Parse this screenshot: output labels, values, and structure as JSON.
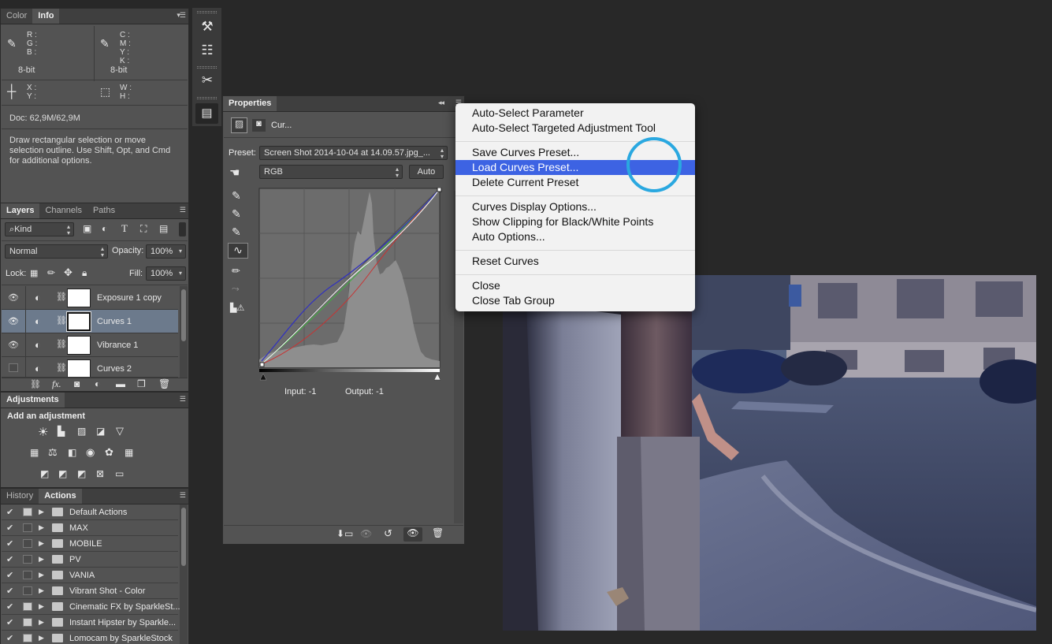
{
  "info_panel": {
    "tabs": [
      "Color",
      "Info"
    ],
    "rgb_labels": [
      "R :",
      "G :",
      "B :"
    ],
    "cmyk_labels": [
      "C :",
      "M :",
      "Y :",
      "K :"
    ],
    "bit_left": "8-bit",
    "bit_right": "8-bit",
    "xy_labels": [
      "X :",
      "Y :"
    ],
    "wh_labels": [
      "W :",
      "H :"
    ],
    "doc": "Doc: 62,9M/62,9M",
    "hint": "Draw rectangular selection or move selection outline.  Use Shift, Opt, and Cmd for additional options."
  },
  "layers_panel": {
    "tabs": [
      "Layers",
      "Channels",
      "Paths"
    ],
    "kind": "Kind",
    "blend_mode": "Normal",
    "opacity_label": "Opacity:",
    "opacity_value": "100%",
    "lock_label": "Lock:",
    "fill_label": "Fill:",
    "fill_value": "100%",
    "layers": [
      {
        "name": "Exposure 1 copy"
      },
      {
        "name": "Curves 1"
      },
      {
        "name": "Vibrance 1"
      },
      {
        "name": "Curves 2"
      }
    ]
  },
  "adjustments_panel": {
    "title": "Adjustments",
    "subtitle": "Add an adjustment"
  },
  "actions_panel": {
    "tabs": [
      "History",
      "Actions"
    ],
    "actions": [
      {
        "name": "Default Actions"
      },
      {
        "name": "MAX"
      },
      {
        "name": "MOBILE"
      },
      {
        "name": "PV"
      },
      {
        "name": "VANIA"
      },
      {
        "name": "Vibrant Shot - Color"
      },
      {
        "name": "Cinematic FX by SparkleSt..."
      },
      {
        "name": "Instant Hipster by Sparkle..."
      },
      {
        "name": "Lomocam by SparkleStock"
      }
    ]
  },
  "properties_panel": {
    "title": "Properties",
    "adjustment_name": "Cur...",
    "preset_label": "Preset:",
    "preset_value": "Screen Shot 2014-10-04 at 14.09.57.jpg_...",
    "channel": "RGB",
    "auto_label": "Auto",
    "input_label": "Input: -1",
    "output_label": "Output: -1"
  },
  "context_menu": {
    "items": [
      "Auto-Select Parameter",
      "Auto-Select Targeted Adjustment Tool",
      "Save Curves Preset...",
      "Load Curves Preset...",
      "Delete Current Preset",
      "Curves Display Options...",
      "Show Clipping for Black/White Points",
      "Auto Options...",
      "Reset Curves",
      "Close",
      "Close Tab Group"
    ],
    "highlighted": "Load Curves Preset..."
  },
  "colors": {
    "panel_bg": "#535353",
    "menu_highlight": "#3d63e3",
    "cursor_ring": "#2aa8e0",
    "selected_layer": "#6c7a8c"
  }
}
